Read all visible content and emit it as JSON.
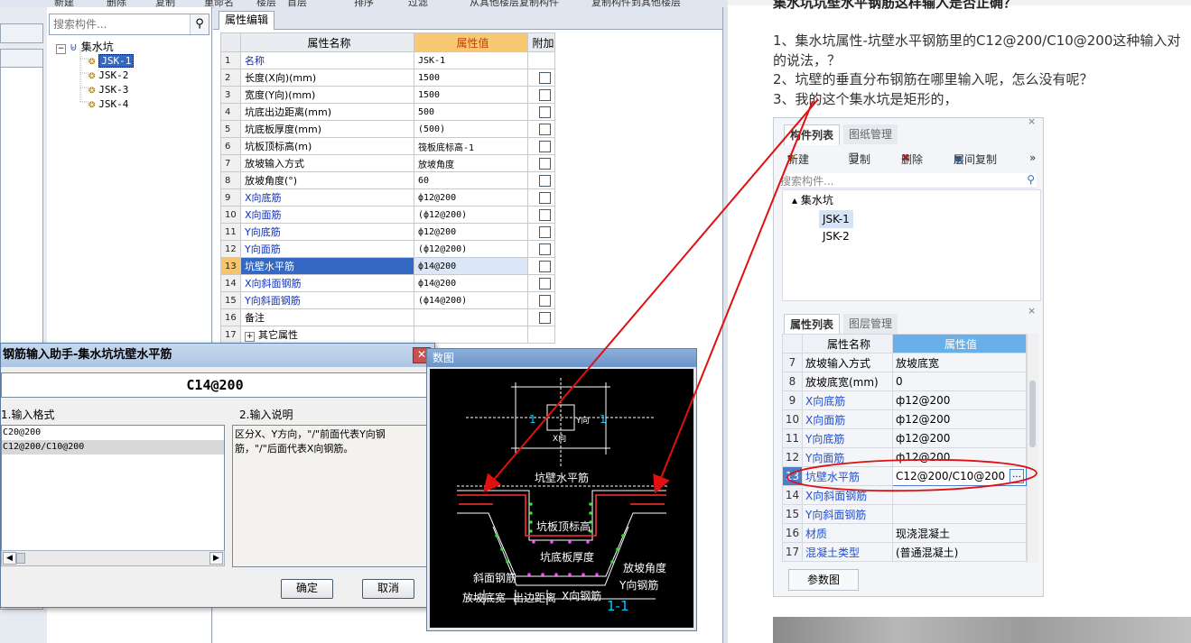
{
  "toolbar": {
    "items": [
      "新建",
      "删除",
      "复制",
      "重命名",
      "楼层",
      "首层",
      "排序",
      "过滤",
      "从其他楼层复制构件",
      "复制构件到其他楼层"
    ]
  },
  "tree": {
    "search_placeholder": "搜索构件...",
    "search_icon": "magnifier-icon",
    "root_label": "集水坑",
    "items": [
      "JSK-1",
      "JSK-2",
      "JSK-3",
      "JSK-4"
    ],
    "selected": "JSK-1"
  },
  "main": {
    "tab_label": "属性编辑",
    "columns": [
      "属性名称",
      "属性值",
      "附加"
    ],
    "rows": [
      {
        "num": "1",
        "name": "名称",
        "value": "JSK-1",
        "blue": true,
        "checkbox": false
      },
      {
        "num": "2",
        "name": "长度(X向)(mm)",
        "value": "1500",
        "blue": false,
        "checkbox": true
      },
      {
        "num": "3",
        "name": "宽度(Y向)(mm)",
        "value": "1500",
        "blue": false,
        "checkbox": true
      },
      {
        "num": "4",
        "name": "坑底出边距离(mm)",
        "value": "500",
        "blue": false,
        "checkbox": true
      },
      {
        "num": "5",
        "name": "坑底板厚度(mm)",
        "value": "(500)",
        "blue": false,
        "checkbox": true
      },
      {
        "num": "6",
        "name": "坑板顶标高(m)",
        "value": "筏板底标高-1",
        "blue": false,
        "checkbox": true
      },
      {
        "num": "7",
        "name": "放坡输入方式",
        "value": "放坡角度",
        "blue": false,
        "checkbox": true
      },
      {
        "num": "8",
        "name": "放坡角度(°)",
        "value": "60",
        "blue": false,
        "checkbox": true
      },
      {
        "num": "9",
        "name": "X向底筋",
        "value": "ф12@200",
        "blue": true,
        "checkbox": true
      },
      {
        "num": "10",
        "name": "X向面筋",
        "value": "(ф12@200)",
        "blue": true,
        "checkbox": true
      },
      {
        "num": "11",
        "name": "Y向底筋",
        "value": "ф12@200",
        "blue": true,
        "checkbox": true
      },
      {
        "num": "12",
        "name": "Y向面筋",
        "value": "(ф12@200)",
        "blue": true,
        "checkbox": true
      },
      {
        "num": "13",
        "name": "坑壁水平筋",
        "value": "ф14@200",
        "blue": false,
        "checkbox": true,
        "selected": true
      },
      {
        "num": "14",
        "name": "X向斜面钢筋",
        "value": "ф14@200",
        "blue": true,
        "checkbox": true
      },
      {
        "num": "15",
        "name": "Y向斜面钢筋",
        "value": "(ф14@200)",
        "blue": true,
        "checkbox": true
      },
      {
        "num": "16",
        "name": "备注",
        "value": "",
        "blue": false,
        "checkbox": true
      },
      {
        "num": "17",
        "name": "其它属性",
        "value": "",
        "blue": false,
        "checkbox": false,
        "expander": "+"
      }
    ]
  },
  "dialog": {
    "title": "钢筋输入助手-集水坑坑壁水平筋",
    "close_glyph": "✕",
    "input_value": "C14@200",
    "format_label": "1.输入格式",
    "desc_label": "2.输入说明",
    "formats": [
      "C20@200",
      "C12@200/C10@200"
    ],
    "selected_format": "C12@200/C10@200",
    "description": "区分X、Y方向，\"/\"前面代表Y向钢筋，\"/\"后面代表X向钢筋。",
    "ok_label": "确定",
    "cancel_label": "取消"
  },
  "diagram": {
    "title": "数图",
    "labels": {
      "section_mark_left": "1",
      "section_mark_right": "1",
      "y_dir": "Y向",
      "x_dir": "X向",
      "wall_horiz": "坑壁水平筋",
      "plate_top": "坑板顶标高",
      "slope_rebar": "斜面钢筋",
      "bottom_thick": "坑底板厚度",
      "slope_angle": "放坡角度",
      "y_rebar": "Y向钢筋",
      "x_rebar": "X向钢筋",
      "slope_width": "放坡底宽",
      "edge_dist": "出边距离",
      "section": "1-1"
    }
  },
  "web": {
    "title_line": "集水坑坑壁水平钢筋这样输入是否正确？",
    "lines": [
      "1、集水坑属性-坑壁水平钢筋里的C12@200/C10@200这种输入对",
      "的说法，？",
      "2、坑壁的垂直分布钢筋在哪里输入呢，怎么没有呢？",
      "3、我的这个集水坑是矩形的，"
    ]
  },
  "shot": {
    "tabs1": [
      "构件列表",
      "图纸管理"
    ],
    "toolbar": [
      "新建",
      "复制",
      "删除",
      "层间复制"
    ],
    "search_placeholder": "搜索构件...",
    "root": "集水坑",
    "items": [
      "JSK-1",
      "JSK-2"
    ],
    "selected": "JSK-1",
    "tabs2": [
      "属性列表",
      "图层管理"
    ],
    "columns": [
      "属性名称",
      "属性值"
    ],
    "rows": [
      {
        "num": "7",
        "name": "放坡输入方式",
        "value": "放坡底宽",
        "blue": false
      },
      {
        "num": "8",
        "name": "放坡底宽(mm)",
        "value": "0",
        "blue": false
      },
      {
        "num": "9",
        "name": "X向底筋",
        "value": "ф12@200",
        "blue": true
      },
      {
        "num": "10",
        "name": "X向面筋",
        "value": "ф12@200",
        "blue": true
      },
      {
        "num": "11",
        "name": "Y向底筋",
        "value": "ф12@200",
        "blue": true
      },
      {
        "num": "12",
        "name": "Y向面筋",
        "value": "ф12@200",
        "blue": true
      },
      {
        "num": "13",
        "name": "坑壁水平筋",
        "value": "C12@200/C10@200",
        "blue": true,
        "selected": true
      },
      {
        "num": "14",
        "name": "X向斜面钢筋",
        "value": "",
        "blue": true
      },
      {
        "num": "15",
        "name": "Y向斜面钢筋",
        "value": "",
        "blue": true
      },
      {
        "num": "16",
        "name": "材质",
        "value": "现浇混凝土",
        "blue": true
      },
      {
        "num": "17",
        "name": "混凝土类型",
        "value": "(普通混凝土)",
        "blue": true
      }
    ],
    "param_button": "参数图",
    "ellipsis": "…"
  },
  "colors": {
    "annotation": "#e01010",
    "selection": "#3369c4",
    "header_value": "#f8c872"
  }
}
